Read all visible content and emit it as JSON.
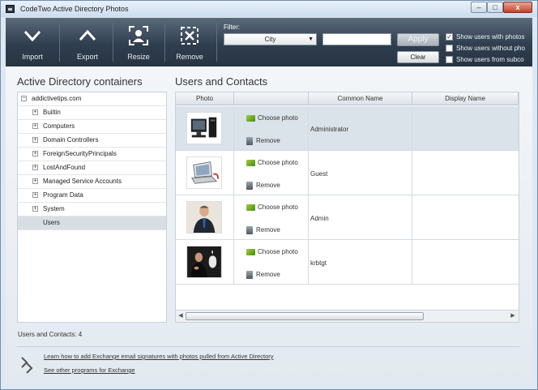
{
  "window": {
    "title": "CodeTwo Active Directory Photos",
    "controls": {
      "minimize": "–",
      "maximize": "□",
      "close": "x"
    }
  },
  "toolbar": {
    "import_label": "Import",
    "export_label": "Export",
    "resize_label": "Resize",
    "remove_label": "Remove",
    "filter_label": "Filter:",
    "filter_select_value": "City",
    "filter_input_value": "",
    "apply_label": "Apply",
    "clear_label": "Clear",
    "checkboxes": [
      {
        "label": "Show users with photos",
        "checked": true
      },
      {
        "label": "Show users without pho",
        "checked": false
      },
      {
        "label": "Show users from subco",
        "checked": false
      }
    ]
  },
  "left_panel": {
    "heading": "Active Directory containers",
    "root": "addictivetips.com",
    "items": [
      "Builtin",
      "Computers",
      "Domain Controllers",
      "ForeignSecurityPrincipals",
      "LostAndFound",
      "Managed Service Accounts",
      "Program Data",
      "System",
      "Users"
    ]
  },
  "right_panel": {
    "heading": "Users and Contacts",
    "columns": [
      "Photo",
      "",
      "Common Name",
      "Display Name"
    ],
    "choose_photo_label": "Choose photo",
    "remove_label": "Remove",
    "rows": [
      {
        "common_name": "Administrator",
        "display_name": "",
        "photo": "computer"
      },
      {
        "common_name": "Guest",
        "display_name": "",
        "photo": "laptop"
      },
      {
        "common_name": "Admin",
        "display_name": "",
        "photo": "man-in-suit"
      },
      {
        "common_name": "krbtgt",
        "display_name": "",
        "photo": "presenter"
      }
    ]
  },
  "status": {
    "text": "Users and Contacts:  4"
  },
  "footer": {
    "link1": "Learn how to add Exchange email signatures with photos pulled from Active Directory",
    "link2": "See other programs for Exchange"
  },
  "colors": {
    "toolbar_bg": "#2f3e4f",
    "window_bg": "#dfe8f2",
    "selection": "#dbe3ea"
  }
}
